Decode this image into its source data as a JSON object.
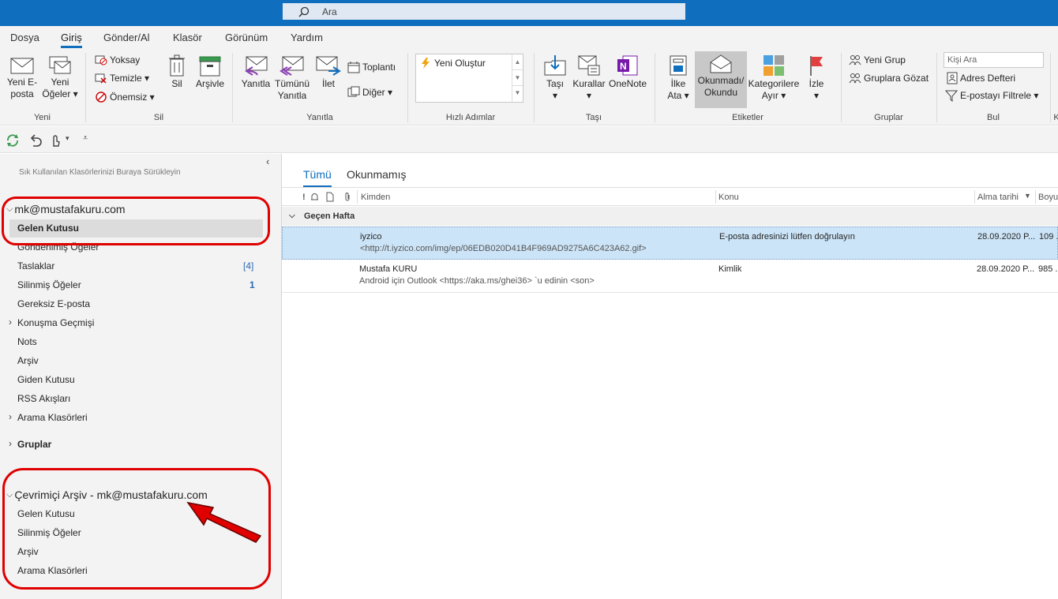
{
  "search": {
    "placeholder": "Ara"
  },
  "menu": [
    "Dosya",
    "Giriş",
    "Gönder/Al",
    "Klasör",
    "Görünüm",
    "Yardım"
  ],
  "ribbon": {
    "new_email": [
      "Yeni E-",
      "posta"
    ],
    "new_items": [
      "Yeni",
      "Öğeler ▾"
    ],
    "ignore": "Yoksay",
    "cleanup": "Temizle ▾",
    "junk": "Önemsiz ▾",
    "delete": "Sil",
    "archive": "Arşivle",
    "reply": "Yanıtla",
    "reply_all": [
      "Tümünü",
      "Yanıtla"
    ],
    "forward": "İlet",
    "meeting": "Toplantı",
    "more": "Diğer ▾",
    "quick_new": "Yeni Oluştur",
    "move": [
      "Taşı",
      "▾"
    ],
    "rules": [
      "Kurallar",
      "▾"
    ],
    "onenote": "OneNote",
    "assign": [
      "İlke",
      "Ata ▾"
    ],
    "unread": [
      "Okunmadı/",
      "Okundu"
    ],
    "categorize": [
      "Kategorilere",
      "Ayır ▾"
    ],
    "follow": [
      "İzle",
      "▾"
    ],
    "new_group": "Yeni Grup",
    "browse_groups": "Gruplara Gözat",
    "search_people": "Kişi Ara",
    "address_book": "Adres Defteri",
    "filter_email": "E-postayı Filtrele ▾",
    "group_labels": [
      "Yeni",
      "Sil",
      "Yanıtla",
      "Hızlı Adımlar",
      "Taşı",
      "Etiketler",
      "Gruplar",
      "Bul",
      "K"
    ]
  },
  "sidebar": {
    "drag_hint": "Sık Kullanılan Klasörlerinizi Buraya Sürükleyin",
    "account": "mk@mustafakuru.com",
    "folders": [
      "Gelen Kutusu",
      "Gönderilmiş Öğeler",
      "Taslaklar",
      "Silinmiş Öğeler",
      "Gereksiz E-posta",
      "Konuşma Geçmişi",
      "Nots",
      "Arşiv",
      "Giden Kutusu",
      "RSS Akışları",
      "Arama Klasörleri"
    ],
    "drafts_count": "[4]",
    "deleted_count": "1",
    "groups": "Gruplar",
    "archive_account": "Çevrimiçi Arşiv - mk@mustafakuru.com",
    "archive_folders": [
      "Gelen Kutusu",
      "Silinmiş Öğeler",
      "Arşiv",
      "Arama Klasörleri"
    ]
  },
  "tabs": [
    "Tümü",
    "Okunmamış"
  ],
  "columns": {
    "icons": "!",
    "from": "Kimden",
    "subject": "Konu",
    "date": "Alma tarihi",
    "size": "Boyu"
  },
  "group_header": "Geçen Hafta",
  "messages": [
    {
      "from": "iyzico",
      "preview": "<http://t.iyzico.com/img/ep/06EDB020D41B4F969AD9275A6C423A62.gif>",
      "subject": "E-posta adresinizi lütfen doğrulayın",
      "date": "28.09.2020 P...",
      "size": "109 ..."
    },
    {
      "from": "Mustafa KURU",
      "preview": "Android için Outlook <https://aka.ms/ghei36> `u edinin <son>",
      "subject": "Kimlik",
      "date": "28.09.2020 P...",
      "size": "985 ..."
    }
  ],
  "colors": {
    "accent": "#106ebe",
    "highlight": "#e00000"
  }
}
